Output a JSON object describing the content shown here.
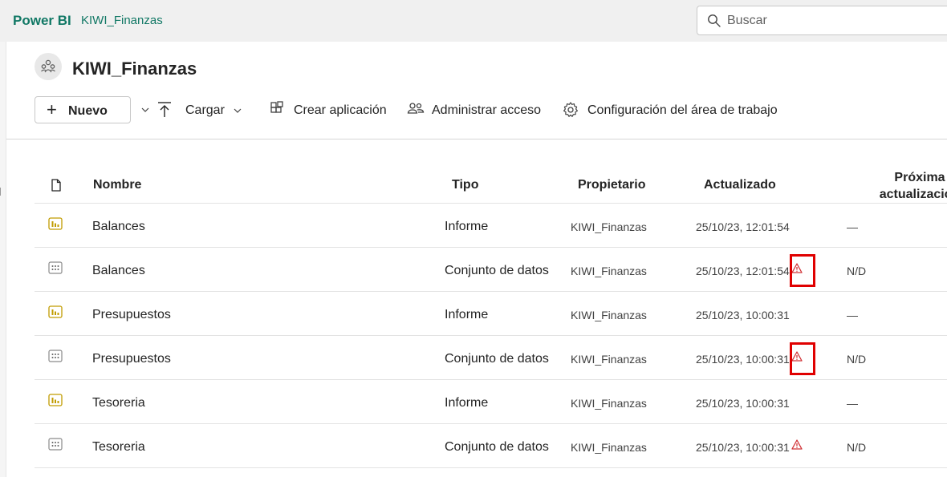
{
  "topbar": {
    "brand": "Power BI",
    "breadcrumb": "KIWI_Finanzas",
    "search_placeholder": "Buscar"
  },
  "workspace": {
    "title": "KIWI_Finanzas"
  },
  "toolbar": {
    "new_label": "Nuevo",
    "upload_label": "Cargar",
    "create_app_label": "Crear aplicación",
    "manage_access_label": "Administrar acceso",
    "settings_label": "Configuración del área de trabajo"
  },
  "table": {
    "columns": {
      "name": "Nombre",
      "type": "Tipo",
      "owner": "Propietario",
      "updated": "Actualizado",
      "next_refresh_line1": "Próxima",
      "next_refresh_line2": "actualización"
    },
    "rows": [
      {
        "icon": "report-icon",
        "name": "Balances",
        "type": "Informe",
        "owner": "KIWI_Finanzas",
        "updated": "25/10/23, 12:01:54",
        "next": "—",
        "warning": false,
        "highlighted": false
      },
      {
        "icon": "dataset-icon",
        "name": "Balances",
        "type": "Conjunto de datos",
        "owner": "KIWI_Finanzas",
        "updated": "25/10/23, 12:01:54",
        "next": "N/D",
        "warning": true,
        "highlighted": true
      },
      {
        "icon": "report-icon",
        "name": "Presupuestos",
        "type": "Informe",
        "owner": "KIWI_Finanzas",
        "updated": "25/10/23, 10:00:31",
        "next": "—",
        "warning": false,
        "highlighted": false
      },
      {
        "icon": "dataset-icon",
        "name": "Presupuestos",
        "type": "Conjunto de datos",
        "owner": "KIWI_Finanzas",
        "updated": "25/10/23, 10:00:31",
        "next": "N/D",
        "warning": true,
        "highlighted": true
      },
      {
        "icon": "report-icon",
        "name": "Tesoreria",
        "type": "Informe",
        "owner": "KIWI_Finanzas",
        "updated": "25/10/23, 10:00:31",
        "next": "—",
        "warning": false,
        "highlighted": false
      },
      {
        "icon": "dataset-icon",
        "name": "Tesoreria",
        "type": "Conjunto de datos",
        "owner": "KIWI_Finanzas",
        "updated": "25/10/23, 10:00:31",
        "next": "N/D",
        "warning": true,
        "highlighted": false
      }
    ]
  },
  "colors": {
    "brand": "#117865",
    "warning": "#d13438",
    "highlight_box": "#e00000",
    "report_icon": "#c19c00"
  }
}
